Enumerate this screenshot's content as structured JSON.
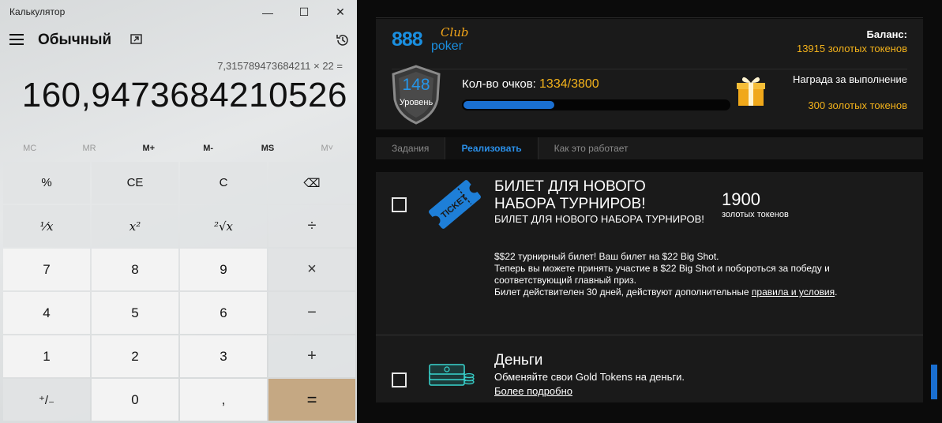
{
  "calculator": {
    "window_title": "Калькулятор",
    "window_buttons": {
      "minimize": "—",
      "maximize": "☐",
      "close": "✕"
    },
    "mode": "Обычный",
    "expression": "7,315789473684211 × 22 =",
    "display": "160,9473684210526",
    "memory": [
      "MC",
      "MR",
      "M+",
      "M-",
      "MS",
      "M˅"
    ],
    "keys": {
      "percent": "%",
      "ce": "CE",
      "c": "C",
      "backspace": "⌫",
      "reciprocal": "¹⁄x",
      "square": "x²",
      "sqrt": "²√x",
      "divide": "÷",
      "seven": "7",
      "eight": "8",
      "nine": "9",
      "multiply": "×",
      "four": "4",
      "five": "5",
      "six": "6",
      "minus": "−",
      "one": "1",
      "two": "2",
      "three": "3",
      "plus": "+",
      "negate": "⁺/₋",
      "zero": "0",
      "decimal": ",",
      "equals": "="
    }
  },
  "poker": {
    "logo": {
      "main": "888",
      "club": "Club",
      "poker": "poker"
    },
    "balance_label": "Баланс:",
    "balance_value": "13915 золотых токенов",
    "level_number": "148",
    "level_label": "Уровень",
    "points_label": "Кол-во очков:",
    "points_value": "1334/3800",
    "progress_fraction": 0.351,
    "reward_label": "Награда за выполнение",
    "reward_value": "300 золотых токенов",
    "tabs": [
      "Задания",
      "Реализовать",
      "Как это работает"
    ],
    "offers": [
      {
        "title": "БИЛЕТ ДЛЯ НОВОГО НАБОРА ТУРНИРОВ!",
        "subtitle": "БИЛЕТ ДЛЯ НОВОГО НАБОРА ТУРНИРОВ!",
        "price": "1900",
        "unit": "золотых токенов",
        "desc_line1": "$$22 турнирный билет! Ваш билет на $22 Big Shot.",
        "desc_line2": "Теперь вы можете принять участие в $22 Big Shot и побороться за победу и соответствующий главный приз.",
        "desc_line3": "Билет действителен 30 дней, действуют дополнительные",
        "desc_link": "правила и условия",
        "desc_end": "."
      },
      {
        "title": "Деньги",
        "subtitle": "Обменяйте свои Gold Tokens на деньги.",
        "link": "Более подробно"
      }
    ]
  },
  "colors": {
    "gold": "#f3b21b",
    "blue": "#1a8fe0",
    "equals_key": "#c5a883"
  }
}
